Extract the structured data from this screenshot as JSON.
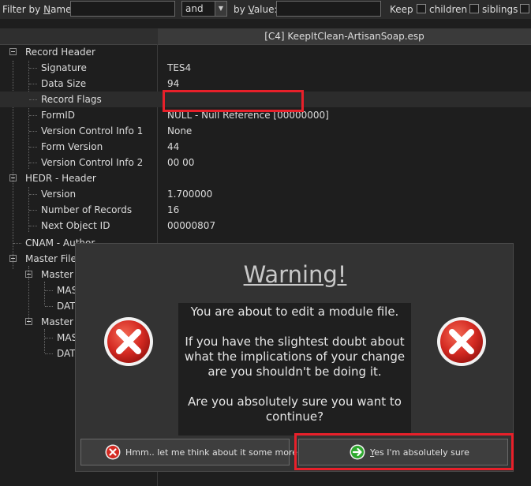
{
  "filter_bar": {
    "filter_by_name_prefix": "Filter by ",
    "filter_by_name_underlined": "N",
    "filter_by_name_suffix": "ame:",
    "name_value": "",
    "operator": "and",
    "by_value_prefix": "by ",
    "by_value_underlined": "V",
    "by_value_suffix": "alue:",
    "value_value": "",
    "keep_label": "Keep",
    "children_label": "children",
    "siblings_label": "siblings"
  },
  "grid": {
    "file_column": "[C4] KeepItClean-ArtisanSoap.esp",
    "rows": [
      {
        "name": "Record Header",
        "value": ""
      },
      {
        "name": "Signature",
        "value": "TES4"
      },
      {
        "name": "Data Size",
        "value": "94"
      },
      {
        "name": "Record Flags",
        "value": ""
      },
      {
        "name": "FormID",
        "value": "NULL - Null Reference [00000000]"
      },
      {
        "name": "Version Control Info 1",
        "value": "None"
      },
      {
        "name": "Form Version",
        "value": "44"
      },
      {
        "name": "Version Control Info 2",
        "value": "00 00"
      },
      {
        "name": "HEDR - Header",
        "value": ""
      },
      {
        "name": "Version",
        "value": "1.700000"
      },
      {
        "name": "Number of Records",
        "value": "16"
      },
      {
        "name": "Next Object ID",
        "value": "00000807"
      },
      {
        "name": "CNAM - Author",
        "value": ""
      },
      {
        "name": "Master Files",
        "value": ""
      },
      {
        "name": "Master F",
        "value": ""
      },
      {
        "name": "MAS",
        "value": ""
      },
      {
        "name": "DATA",
        "value": ""
      },
      {
        "name": "Master F",
        "value": ""
      },
      {
        "name": "MAS",
        "value": ""
      },
      {
        "name": "DATA",
        "value": ""
      }
    ]
  },
  "dialog": {
    "title": "Warning!",
    "line1": "You are about to edit a module file.",
    "line2": "If you have the slightest doubt about what the implications of your change are you shouldn't be doing it.",
    "line3": "Are you absolutely sure you want to continue?",
    "cancel_label": "Hmm.. let me think about it some more",
    "confirm_underlined": "Y",
    "confirm_label_rest": "es I'm absolutely sure"
  },
  "colors": {
    "highlight_red": "#e8202a",
    "icon_red": "#d42a22",
    "icon_green": "#2ea82e",
    "background": "#1e1e1e"
  },
  "icons": {
    "warning": "x-circle-icon",
    "cancel": "x-circle-icon",
    "confirm": "arrow-right-circle-icon"
  }
}
